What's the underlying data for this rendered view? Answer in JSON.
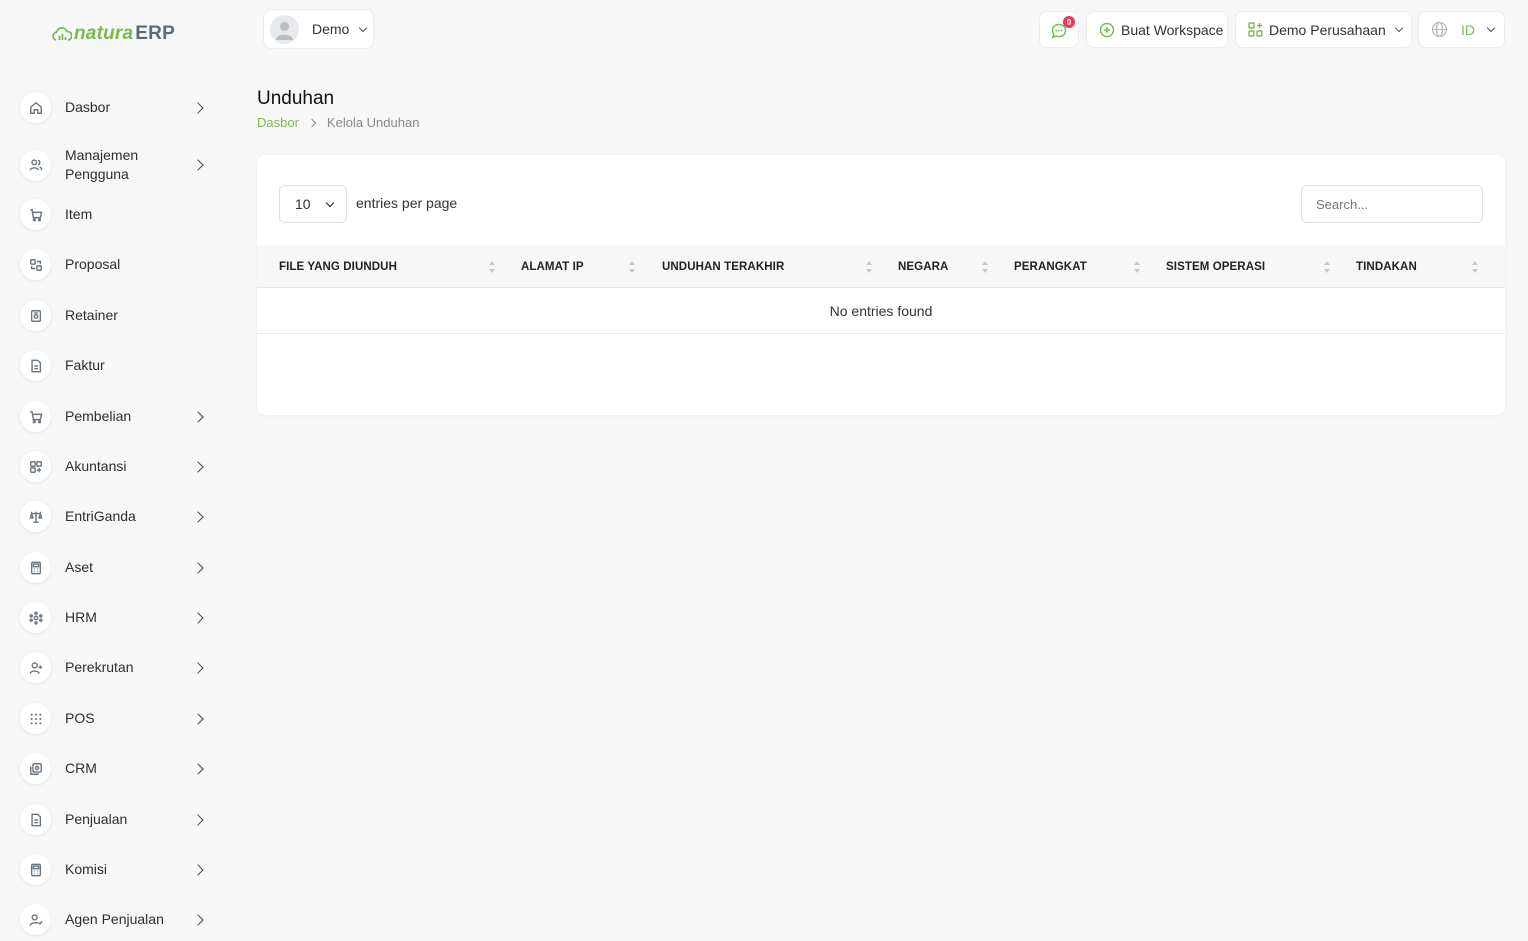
{
  "brand": {
    "name_part1": "natura",
    "name_part2": "ERP"
  },
  "sidebar": {
    "items": [
      {
        "label": "Dasbor",
        "icon": "home-icon",
        "has_children": true
      },
      {
        "label": "Manajemen Pengguna",
        "icon": "users-icon",
        "has_children": true
      },
      {
        "label": "Item",
        "icon": "cart-icon",
        "has_children": false
      },
      {
        "label": "Proposal",
        "icon": "proposal-icon",
        "has_children": false
      },
      {
        "label": "Retainer",
        "icon": "retainer-icon",
        "has_children": false
      },
      {
        "label": "Faktur",
        "icon": "file-icon",
        "has_children": false
      },
      {
        "label": "Pembelian",
        "icon": "cart-icon",
        "has_children": true
      },
      {
        "label": "Akuntansi",
        "icon": "grid-plus-icon",
        "has_children": true
      },
      {
        "label": "EntriGanda",
        "icon": "scale-icon",
        "has_children": true
      },
      {
        "label": "Aset",
        "icon": "calculator-icon",
        "has_children": true
      },
      {
        "label": "HRM",
        "icon": "hrm-icon",
        "has_children": true
      },
      {
        "label": "Perekrutan",
        "icon": "user-plus-icon",
        "has_children": true
      },
      {
        "label": "POS",
        "icon": "dots-grid-icon",
        "has_children": true
      },
      {
        "label": "CRM",
        "icon": "crm-icon",
        "has_children": true
      },
      {
        "label": "Penjualan",
        "icon": "file-icon",
        "has_children": true
      },
      {
        "label": "Komisi",
        "icon": "calculator-icon",
        "has_children": true
      },
      {
        "label": "Agen Penjualan",
        "icon": "user-check-icon",
        "has_children": true
      }
    ]
  },
  "header": {
    "user_name": "Demo",
    "notification_count": "0",
    "create_workspace_label": "Buat Workspace",
    "company_label": "Demo Perusahaan",
    "language_label": "ID"
  },
  "page": {
    "title": "Unduhan",
    "breadcrumb": {
      "home": "Dasbor",
      "current": "Kelola Unduhan"
    }
  },
  "table": {
    "per_page_value": "10",
    "per_page_text": "entries per page",
    "search_placeholder": "Search...",
    "columns": [
      "FILE YANG DIUNDUH",
      "ALAMAT IP",
      "UNDUHAN TERAKHIR",
      "NEGARA",
      "PERANGKAT",
      "SISTEM OPERASI",
      "TINDAKAN"
    ],
    "empty_text": "No entries found"
  },
  "colors": {
    "accent": "#7cba4e",
    "badge": "#e8385a",
    "background": "#f6f7f6"
  }
}
